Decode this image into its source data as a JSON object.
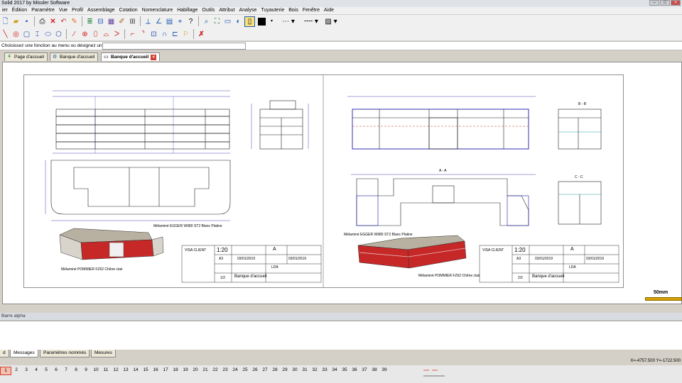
{
  "window": {
    "title": "Solid 2017 by Missler Software"
  },
  "menu": [
    "ier",
    "Édition",
    "Paramètre",
    "Vue",
    "Profil",
    "Assemblage",
    "Cotation",
    "Nomenclature",
    "Habillage",
    "Outils",
    "Attribut",
    "Analyse",
    "Tuyauterie",
    "Bois",
    "Fenêtre",
    "Aide"
  ],
  "toolbar1_icons": [
    "new-icon",
    "save-icon",
    "print-icon",
    "undo-icon",
    "delete-icon",
    "redo-icon",
    "brush-icon",
    "layers-icon",
    "dimension-icon",
    "texture-icon",
    "edit-icon",
    "grid-icon",
    "measure-icon",
    "table-icon",
    "zoom-icon",
    "fit-icon",
    "view-icon",
    "render-icon",
    "color-icon",
    "line-style-icon",
    "hatch-icon"
  ],
  "toolbar2_icons": [
    "line-icon",
    "circle-icon",
    "rectangle-icon",
    "polyline-icon",
    "ellipse-icon",
    "hexagon-icon",
    "spline-icon",
    "point-icon",
    "oval-icon",
    "arc-icon",
    "fillet-icon",
    "chamfer-icon",
    "offset-icon",
    "trim-icon",
    "extend-icon",
    "text-icon",
    "erase-icon"
  ],
  "command": {
    "prompt": "Choisissez une fonction au menu ou désignez un élément"
  },
  "tabs": [
    {
      "label": "Page d'accueil"
    },
    {
      "label": "Banque d'accueil"
    },
    {
      "label": "Banque d'accueil"
    }
  ],
  "drawing": {
    "left_note": "Mélaminé EGGER W980 ST2 Blanc Platine",
    "left_note2": "Mélaminé POMMIER FZ62 Chêne clair",
    "right_note": "Mélaminé EGGER W980 ST2 Blanc Platine",
    "right_note2": "Mélaminé POMMIER FZ62 Chêne clair",
    "section_bb": "B - B",
    "section_aa": "A - A",
    "section_cc": "C - C",
    "cartouche_left": {
      "scale": "1:20",
      "format": "A3",
      "sheet": "1/2",
      "title": "Banque d'accueil",
      "date1": "03/01/2019",
      "date2": "03/01/2019",
      "designer": "LDA",
      "client_label": "VISA CLIENT",
      "rev": "A"
    },
    "cartouche_right": {
      "scale": "1:20",
      "format": "A3",
      "sheet": "2/2",
      "title": "Banque d'accueil",
      "date1": "03/01/2019",
      "date2": "03/01/2019",
      "designer": "LDA",
      "client_label": "VISA CLIENT",
      "rev": "A"
    }
  },
  "scale_bar": {
    "label": "50mm"
  },
  "alpha": {
    "label": "Barre alpha"
  },
  "bottom_tabs": [
    "d",
    "Messages",
    "Paramètres nommés",
    "Mesures"
  ],
  "coords": "X=-4757.500 Y=-1722.500",
  "pages": [
    "1",
    "2",
    "3",
    "4",
    "5",
    "6",
    "7",
    "8",
    "9",
    "10",
    "11",
    "12",
    "13",
    "14",
    "15",
    "16",
    "17",
    "18",
    "19",
    "20",
    "21",
    "22",
    "23",
    "24",
    "25",
    "26",
    "27",
    "28",
    "29",
    "30",
    "31",
    "32",
    "33",
    "34",
    "35",
    "36",
    "37",
    "38",
    "39"
  ],
  "colors": {
    "accent_red": "#c62828",
    "dim_blue": "#1a1aa8",
    "scale_gold": "#d6a000"
  }
}
